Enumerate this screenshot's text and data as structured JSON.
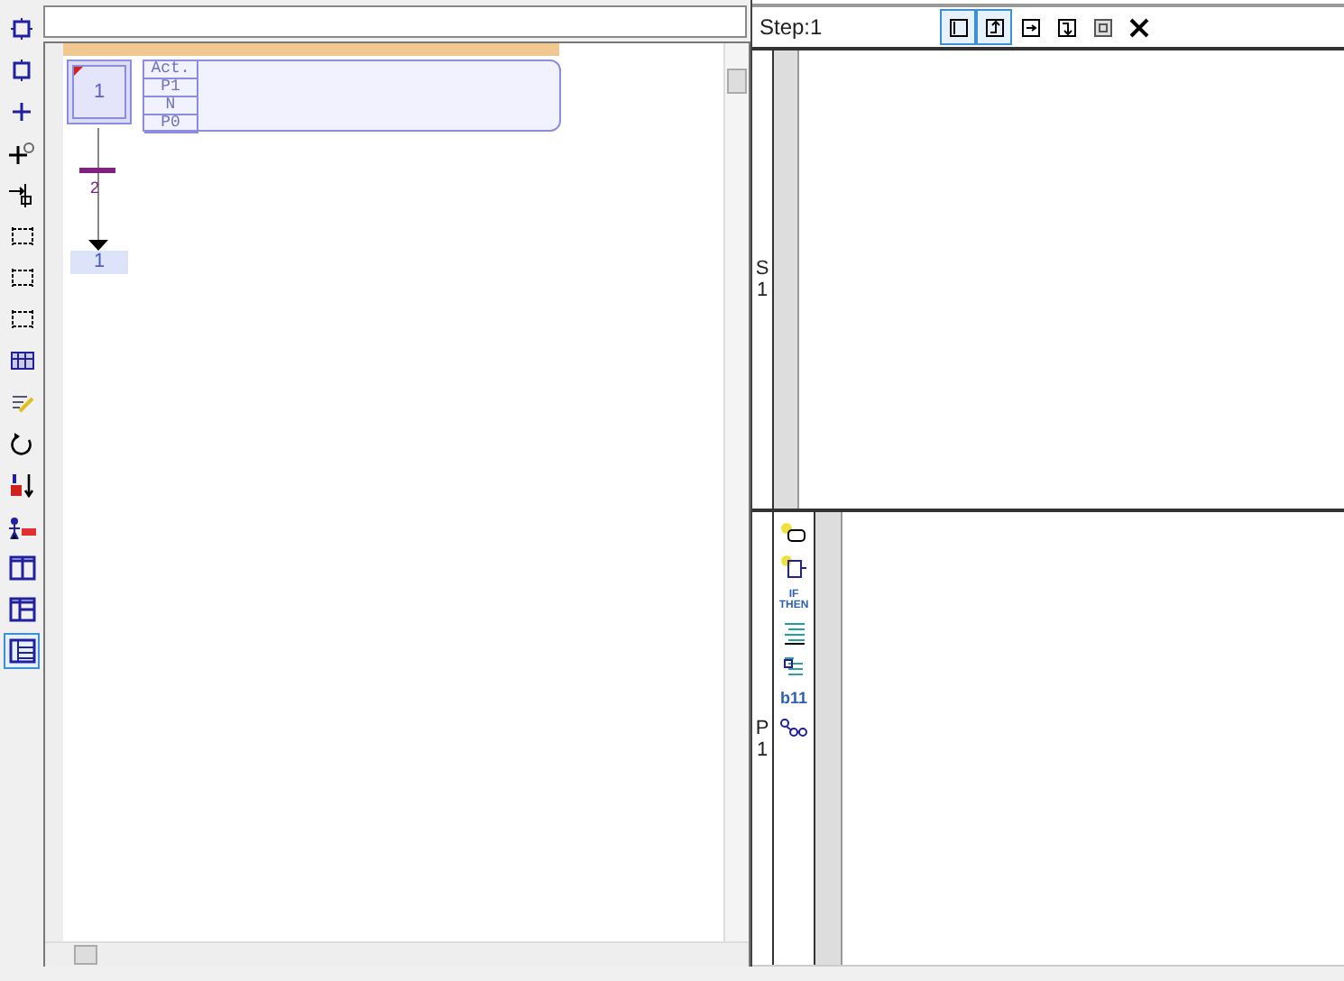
{
  "left_toolbar": [
    {
      "kind": "chip",
      "selected": false
    },
    {
      "kind": "step",
      "selected": false
    },
    {
      "kind": "plus",
      "selected": false
    },
    {
      "kind": "plus-clock",
      "selected": false
    },
    {
      "kind": "arrow-step",
      "selected": false
    },
    {
      "kind": "bracket",
      "selected": false
    },
    {
      "kind": "bracket",
      "selected": false
    },
    {
      "kind": "bracket",
      "selected": false
    },
    {
      "kind": "table",
      "selected": false
    },
    {
      "kind": "pencil",
      "selected": false
    },
    {
      "kind": "loop",
      "selected": false
    },
    {
      "kind": "sort",
      "selected": false
    },
    {
      "kind": "person",
      "selected": false
    },
    {
      "kind": "split",
      "selected": false
    },
    {
      "kind": "split-h",
      "selected": false
    },
    {
      "kind": "list",
      "selected": true
    }
  ],
  "diagram": {
    "step": {
      "number": "1",
      "initial": true
    },
    "actions": [
      "Act.",
      "P1",
      "N",
      "P0"
    ],
    "transition": {
      "number": "2"
    },
    "jump": {
      "target": "1"
    }
  },
  "step_panel": {
    "title": "Step:1",
    "tools": [
      {
        "kind": "frame",
        "selected": true
      },
      {
        "kind": "up",
        "selected": true
      },
      {
        "kind": "right",
        "selected": false
      },
      {
        "kind": "down",
        "selected": false
      },
      {
        "kind": "box",
        "selected": false
      },
      {
        "kind": "close",
        "selected": false
      }
    ]
  },
  "sections": [
    {
      "label": "S",
      "number": "1"
    },
    {
      "label": "P",
      "number": "1"
    }
  ],
  "p_tools": [
    {
      "kind": "bulb-step"
    },
    {
      "kind": "bulb-box"
    },
    {
      "kind": "text",
      "label": "IF THEN"
    },
    {
      "kind": "lines"
    },
    {
      "kind": "doc"
    },
    {
      "kind": "text",
      "label": "b11"
    },
    {
      "kind": "network"
    }
  ]
}
